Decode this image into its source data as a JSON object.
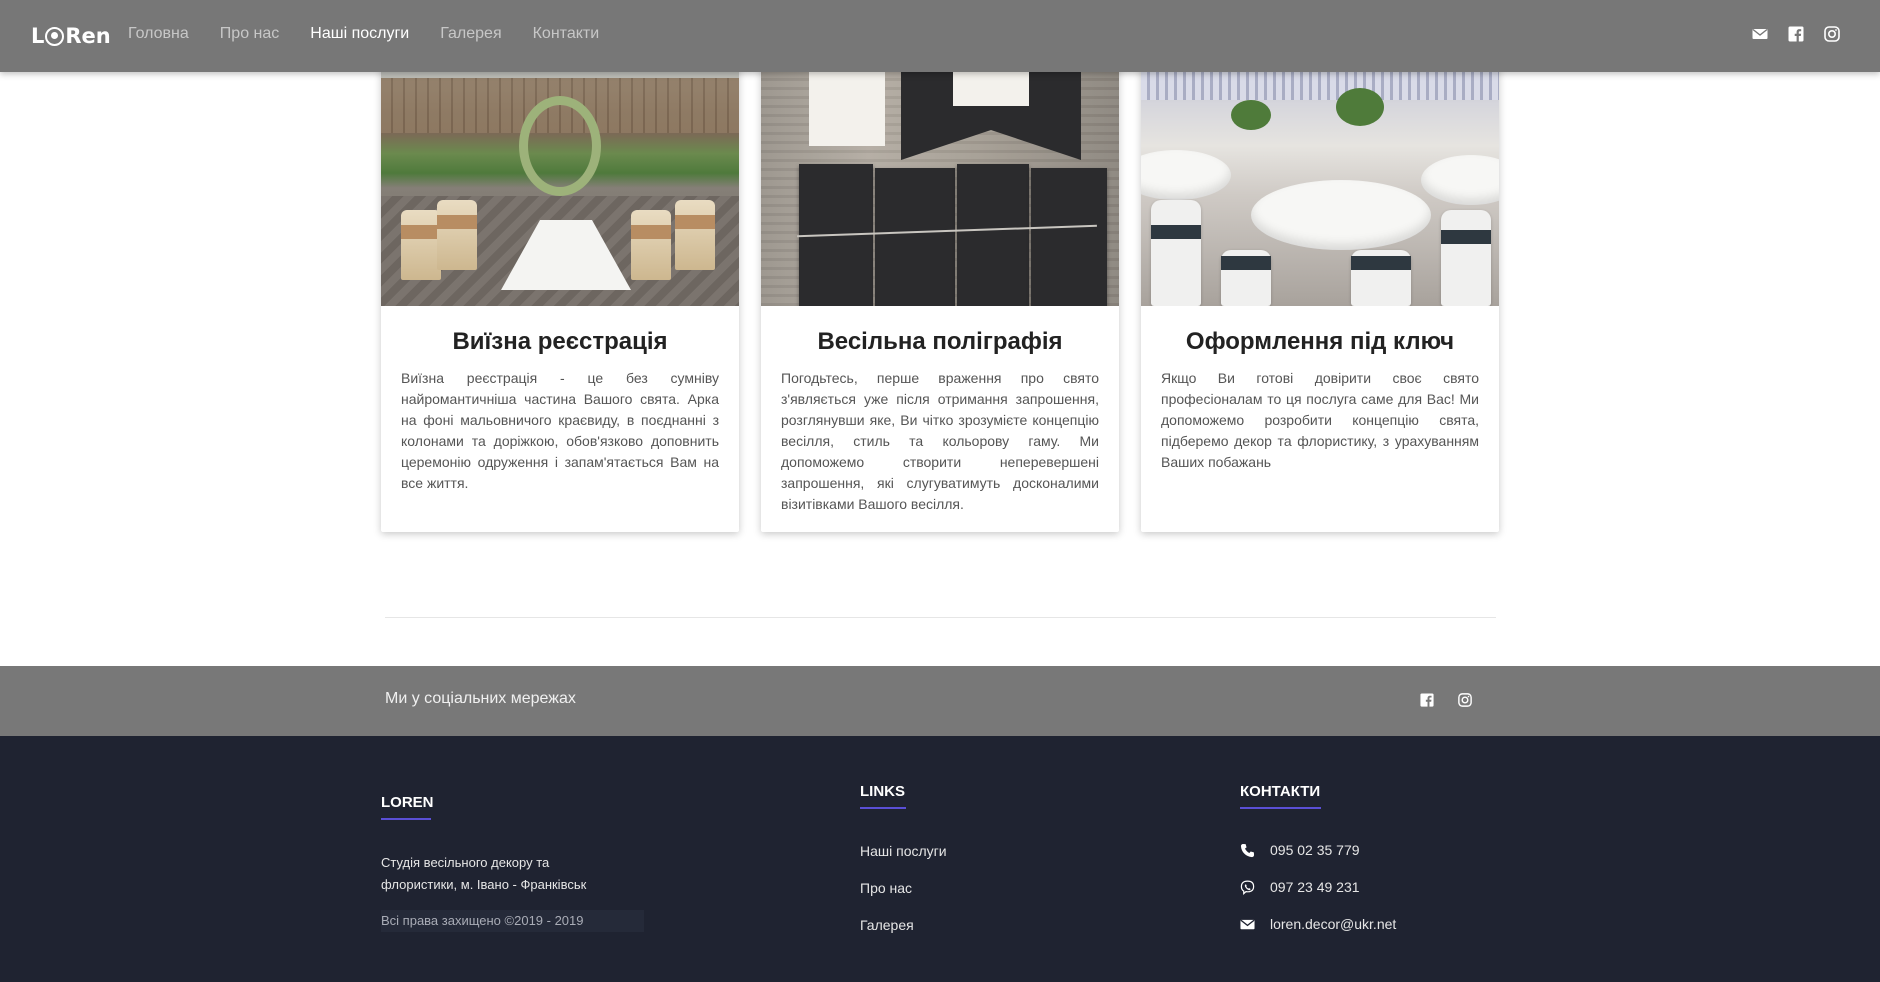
{
  "navbar": {
    "brand": "LORen",
    "links": [
      {
        "label": "Головна"
      },
      {
        "label": "Про нас"
      },
      {
        "label": "Наші послуги"
      },
      {
        "label": "Галерея"
      },
      {
        "label": "Контакти"
      }
    ],
    "active_index": 2,
    "icons": [
      "envelope-icon",
      "facebook-icon",
      "instagram-icon"
    ]
  },
  "services": [
    {
      "title": "Виїзна реєстрація",
      "text": "Виїзна реєстрація - це без сумніву найромантичніша частина Вашого свята. Арка на фоні мальовничого краєвиду, в поєднанні з колонами та доріжкою, обов'язково доповнить церемонію одруження і запам'ятається Вам на все життя."
    },
    {
      "title": "Весільна поліграфія",
      "text": "Погодьтесь, перше враження про свято з'являється уже після отримання запрошення, розглянувши яке, Ви чітко зрозумієте концепцію весілля, стиль та кольорову гаму. Ми допоможемо створити неперевершені запрошення, які слугуватимуть досконалими візитівками Вашого весілля."
    },
    {
      "title": "Оформлення під ключ",
      "text": "Якщо Ви готові довірити своє свято професіоналам то ця послуга саме для Вас! Ми допоможемо розробити концепцію свята, підберемо декор та флористику, з урахуванням Ваших побажань"
    }
  ],
  "social_strip": {
    "label": "Ми у соціальних мережах",
    "icons": [
      "facebook-icon",
      "instagram-icon"
    ]
  },
  "footer": {
    "about": {
      "heading": "LOREN",
      "description": "Студія весільного декору та флористики, м. Івано - Франківськ",
      "copyright": "Всі права захищено ©2019 - 2019"
    },
    "links": {
      "heading": "LINKS",
      "items": [
        "Наші послуги",
        "Про нас",
        "Галерея"
      ]
    },
    "contacts": {
      "heading": "КОНТАКТИ",
      "items": [
        {
          "icon": "phone-icon",
          "text": "095 02 35 779"
        },
        {
          "icon": "viber-icon",
          "text": "097 23 49 231"
        },
        {
          "icon": "envelope-icon",
          "text": "loren.decor@ukr.net"
        }
      ]
    }
  },
  "colors": {
    "navbar_bg": "#777777",
    "social_strip_bg": "#787878",
    "footer_bg": "#1f2331",
    "footer_accent": "#5a4fd6"
  }
}
